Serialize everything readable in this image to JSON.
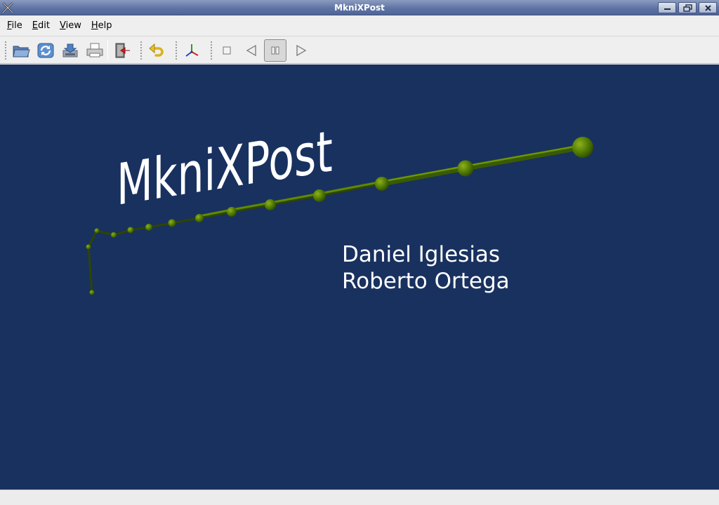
{
  "window": {
    "title": "MkniXPost",
    "app_icon": "x-logo-icon",
    "controls": [
      "minimize-icon",
      "restore-icon",
      "close-icon"
    ]
  },
  "menubar": {
    "items": [
      {
        "label": "File",
        "mnemonic": "F",
        "rest": "ile"
      },
      {
        "label": "Edit",
        "mnemonic": "E",
        "rest": "dit"
      },
      {
        "label": "View",
        "mnemonic": "V",
        "rest": "iew"
      },
      {
        "label": "Help",
        "mnemonic": "H",
        "rest": "elp"
      }
    ]
  },
  "toolbar": {
    "buttons": [
      "open-folder-icon",
      "reload-icon",
      "save-icon",
      "print-icon",
      "exit-icon",
      "undo-icon",
      "axes-icon",
      "stop-icon",
      "play-backward-icon",
      "pause-icon",
      "play-forward-icon"
    ],
    "pressed": "pause-icon"
  },
  "viewport": {
    "logo_text": "MkniXPost",
    "credits": [
      "Daniel Iglesias",
      "Roberto Ortega"
    ],
    "background": "#19315f",
    "model_color": "#4a6b00"
  }
}
